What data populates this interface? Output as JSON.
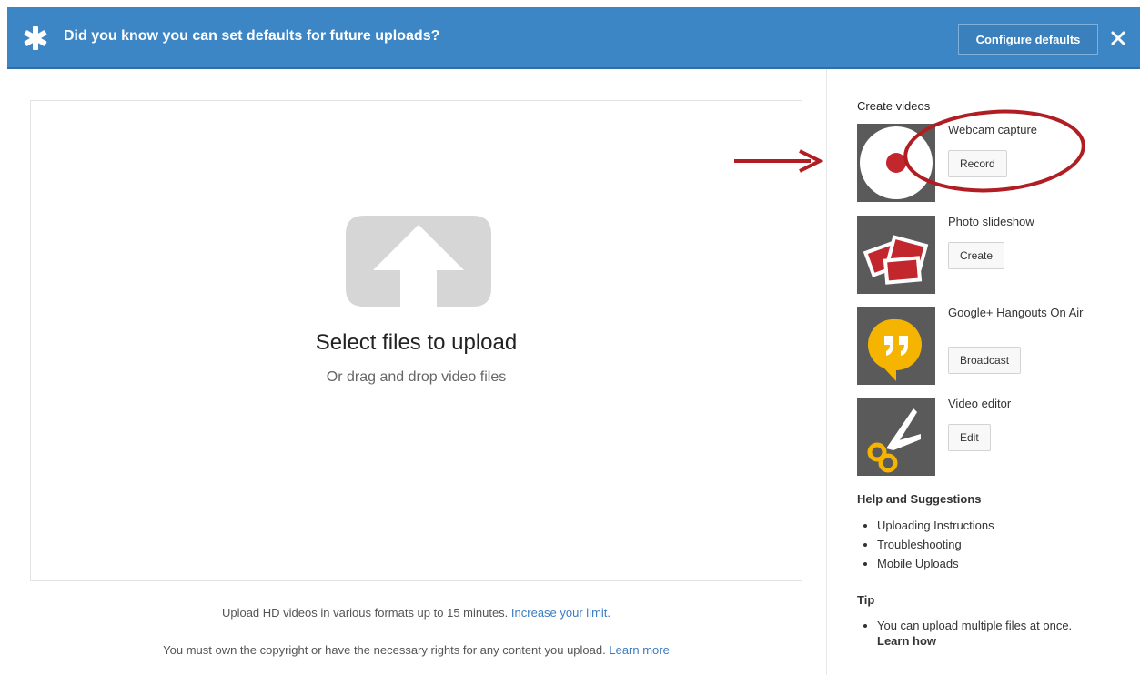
{
  "banner": {
    "message": "Did you know you can set defaults for future uploads?",
    "configure_label": "Configure defaults",
    "star_icon": "star-icon",
    "close_icon": "close-icon"
  },
  "upload": {
    "title": "Select files to upload",
    "subtitle": "Or drag and drop video files",
    "icon": "upload-arrow-icon"
  },
  "notes": {
    "hd_text": "Upload HD videos in various formats up to 15 minutes.",
    "hd_link": "Increase your limit.",
    "copyright_text": "You must own the copyright or have the necessary rights for any content you upload.",
    "copyright_link": "Learn more"
  },
  "sidebar": {
    "create_heading": "Create videos",
    "tools": [
      {
        "name": "Webcam capture",
        "button": "Record",
        "icon": "webcam-record-icon"
      },
      {
        "name": "Photo slideshow",
        "button": "Create",
        "icon": "photo-slideshow-icon"
      },
      {
        "name": "Google+ Hangouts On Air",
        "button": "Broadcast",
        "icon": "hangouts-quote-icon"
      },
      {
        "name": "Video editor",
        "button": "Edit",
        "icon": "scissors-icon"
      }
    ],
    "help_heading": "Help and Suggestions",
    "help_links": [
      "Uploading Instructions",
      "Troubleshooting",
      "Mobile Uploads"
    ],
    "tip_heading": "Tip",
    "tip_text": "You can upload multiple files at once.",
    "tip_link": "Learn how"
  },
  "colors": {
    "banner_bg": "#3d86c5",
    "annotation_red": "#b01e23"
  }
}
